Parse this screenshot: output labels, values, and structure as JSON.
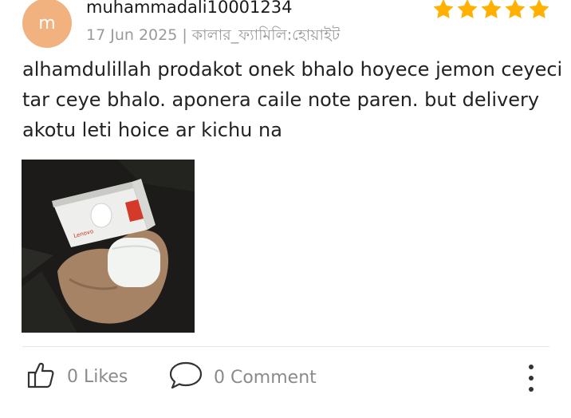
{
  "review": {
    "avatar_letter": "m",
    "username": "muhammadali10001234",
    "date": "17 Jun 2025",
    "separator": "|",
    "variant": "কালার_ফ্যামিলি:হোয়াইট",
    "rating": 5,
    "rating_max": 5,
    "star_color": "#ffb000",
    "text": "alhamdulillah prodakot onek bhalo hoyece jemon ceyeci tar ceye bhalo. aponera caile note paren. but delivery akotu leti hoice ar kichu na"
  },
  "photo": {
    "box_brand_text": "Lenovo"
  },
  "actions": {
    "likes_label": "0 Likes",
    "comment_label": "0 Comment",
    "like_icon": "thumbs-up-icon",
    "comment_icon": "comment-bubble-icon",
    "more_icon": "more-vertical-icon"
  }
}
